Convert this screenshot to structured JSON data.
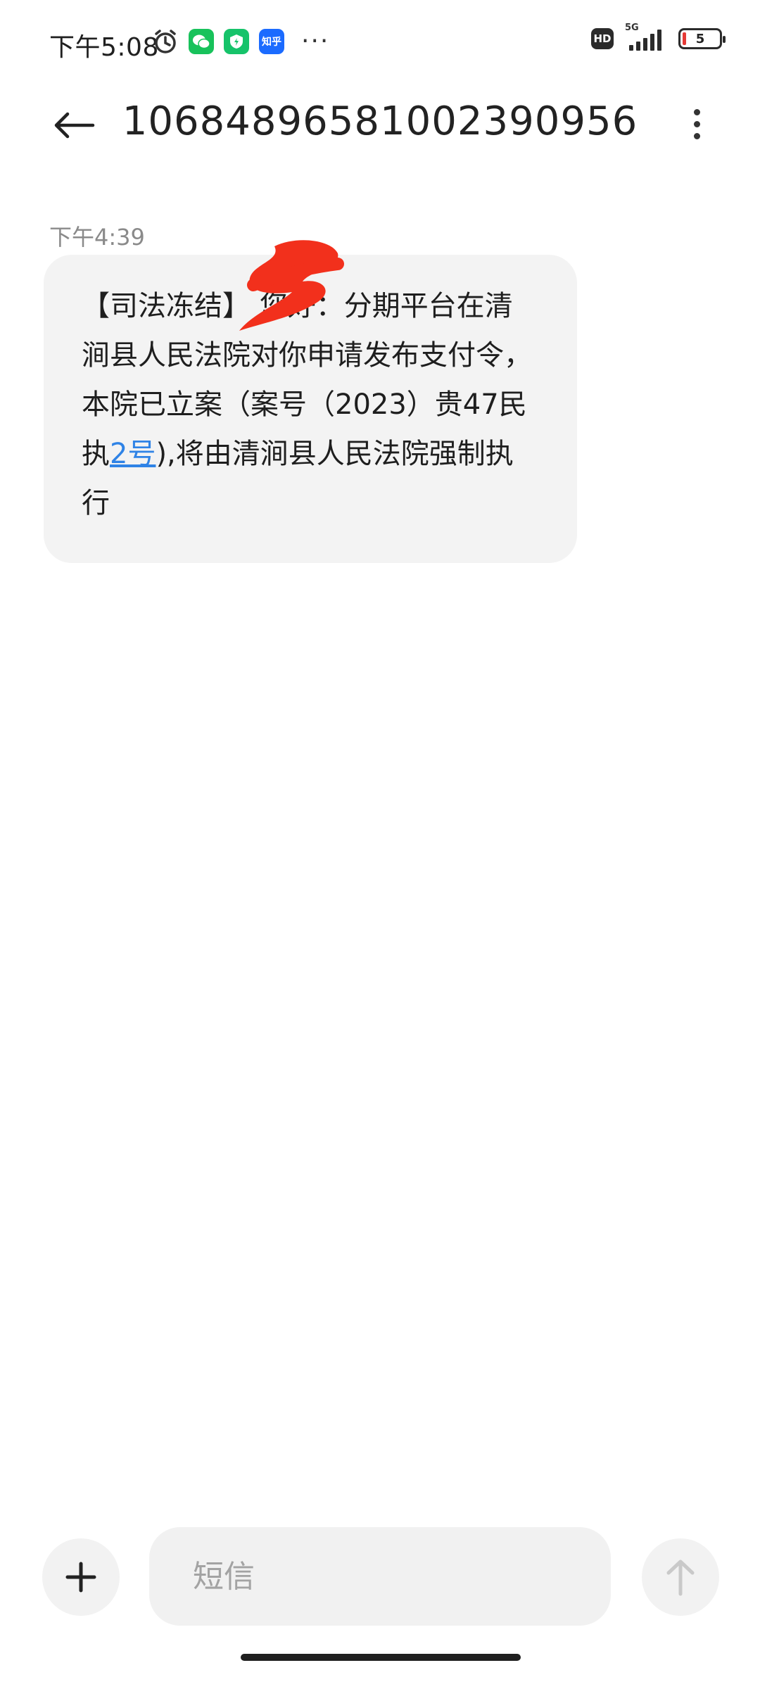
{
  "status_bar": {
    "time": "下午5:08",
    "app_zhihu": "知乎",
    "network": "5G",
    "hd": "HD",
    "battery": "5",
    "colors": {
      "battery_low": "#e53935"
    }
  },
  "header": {
    "title": "106848965810023909​56"
  },
  "message": {
    "time": "下午4:39",
    "text_before_link": "【司法冻结】    您好：分期平台在清涧县人民法院对你申请发布支付令，本院已立案（案号（2023）贵47民执",
    "link_text": "2号",
    "text_after_link": "),将由清涧县人民法院强制执行"
  },
  "composer": {
    "placeholder": "短信"
  },
  "icons": {
    "back": "back-arrow-icon",
    "menu": "more-vertical-icon",
    "add": "plus-icon",
    "send": "arrow-up-icon",
    "alarm": "alarm-icon",
    "wechat": "wechat-icon",
    "shield": "shield-icon"
  }
}
